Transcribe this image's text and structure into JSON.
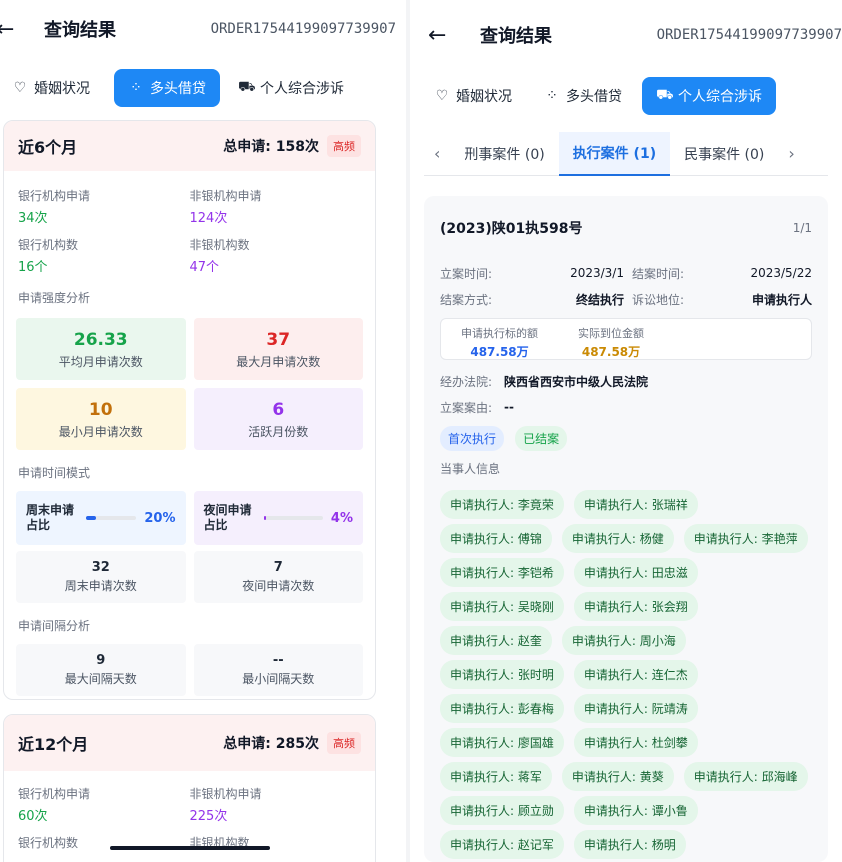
{
  "left": {
    "back": "←",
    "title": "查询结果",
    "order": "ORDER17544199097739907",
    "tabs": [
      {
        "icon": "♡",
        "label": "婚姻状况"
      },
      {
        "icon": "⁘",
        "label": "多头借贷"
      },
      {
        "icon": "⛟",
        "label": "个人综合涉诉"
      }
    ],
    "card6": {
      "title": "近6个月",
      "total": "总申请: 158次",
      "badge": "高频",
      "bank_apply_label": "银行机构申请",
      "bank_apply": "34次",
      "nonbank_apply_label": "非银机构申请",
      "nonbank_apply": "124次",
      "bank_count_label": "银行机构数",
      "bank_count": "16个",
      "nonbank_count_label": "非银机构数",
      "nonbank_count": "47个",
      "intensity_title": "申请强度分析",
      "avg": "26.33",
      "avg_label": "平均月申请次数",
      "max": "37",
      "max_label": "最大月申请次数",
      "min": "10",
      "min_label": "最小月申请次数",
      "active": "6",
      "active_label": "活跃月份数",
      "time_title": "申请时间模式",
      "weekend_label": "周末申请占比",
      "weekend_pct": "20%",
      "weekend_frac": 0.2,
      "night_label": "夜间申请占比",
      "night_pct": "4%",
      "night_frac": 0.04,
      "weekend_count": "32",
      "weekend_count_label": "周末申请次数",
      "night_count": "7",
      "night_count_label": "夜间申请次数",
      "interval_title": "申请间隔分析",
      "max_interval": "9",
      "max_interval_label": "最大间隔天数",
      "min_interval": "--",
      "min_interval_label": "最小间隔天数"
    },
    "card12": {
      "title": "近12个月",
      "total": "总申请: 285次",
      "badge": "高频",
      "bank_apply_label": "银行机构申请",
      "bank_apply": "60次",
      "nonbank_apply_label": "非银机构申请",
      "nonbank_apply": "225次",
      "bank_count_label": "银行机构数",
      "nonbank_count_label": "非银机构数"
    }
  },
  "right": {
    "back": "←",
    "title": "查询结果",
    "order": "ORDER17544199097739907",
    "tabs": [
      {
        "icon": "♡",
        "label": "婚姻状况"
      },
      {
        "icon": "⁘",
        "label": "多头借贷"
      },
      {
        "icon": "⛟",
        "label": "个人综合涉诉"
      }
    ],
    "subtabs": [
      "刑事案件 (0)",
      "执行案件 (1)",
      "民事案件 (0)"
    ],
    "case": {
      "number": "(2023)陕01执598号",
      "page": "1/1",
      "file_date_label": "立案时间:",
      "file_date": "2023/3/1",
      "close_date_label": "结案时间:",
      "close_date": "2023/5/22",
      "close_method_label": "结案方式:",
      "close_method": "终结执行",
      "position_label": "诉讼地位:",
      "position": "申请执行人",
      "exec_amount_label": "申请执行标的额",
      "exec_amount": "487.58万",
      "paid_amount_label": "实际到位金额",
      "paid_amount": "487.58万",
      "court_label": "经办法院:",
      "court": "陕西省西安市中级人民法院",
      "reason_label": "立案案由:",
      "reason": "--",
      "tag1": "首次执行",
      "tag2": "已结案",
      "parties_title": "当事人信息",
      "parties": [
        [
          "申请执行人: 李竟荣",
          "申请执行人: 张瑞祥"
        ],
        [
          "申请执行人: 傅锦",
          "申请执行人: 杨健",
          "申请执行人: 李艳萍"
        ],
        [
          "申请执行人: 李铠希",
          "申请执行人: 田忠滋"
        ],
        [
          "申请执行人: 吴晓刚",
          "申请执行人: 张会翔"
        ],
        [
          "申请执行人: 赵奎",
          "申请执行人: 周小海"
        ],
        [
          "申请执行人: 张时明",
          "申请执行人: 连仁杰"
        ],
        [
          "申请执行人: 彭春梅",
          "申请执行人: 阮靖涛"
        ],
        [
          "申请执行人: 廖国雄",
          "申请执行人: 杜剑攀"
        ],
        [
          "申请执行人: 蒋军",
          "申请执行人: 黄葵",
          "申请执行人: 邱海峰"
        ],
        [
          "申请执行人: 顾立勋",
          "申请执行人: 谭小鲁"
        ],
        [
          "申请执行人: 赵记军",
          "申请执行人: 杨明"
        ]
      ]
    }
  }
}
